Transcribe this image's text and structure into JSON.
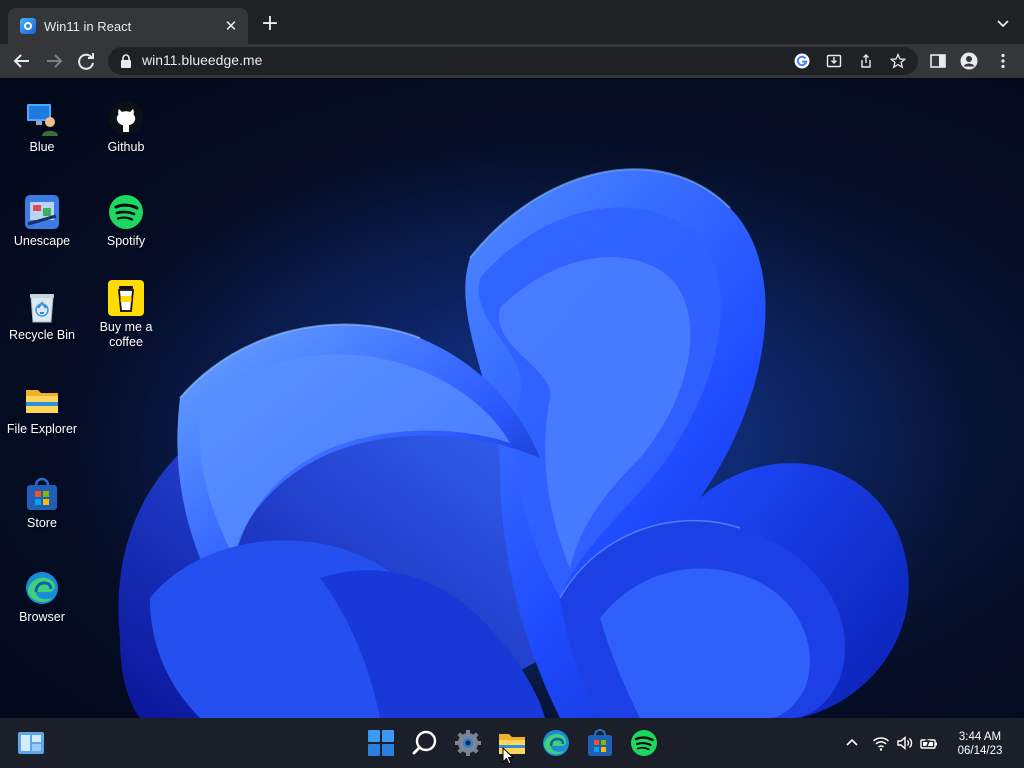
{
  "browser": {
    "tab_title": "Win11 in React",
    "tab_close": "✕",
    "new_tab": "+",
    "url": "win11.blueedge.me"
  },
  "desktop": {
    "icons": [
      {
        "label": "Blue",
        "icon": "user-pc-icon"
      },
      {
        "label": "Unescape",
        "icon": "unescape-icon"
      },
      {
        "label": "Recycle Bin",
        "icon": "recycle-bin-icon"
      },
      {
        "label": "File Explorer",
        "icon": "folder-icon"
      },
      {
        "label": "Store",
        "icon": "store-icon"
      },
      {
        "label": "Browser",
        "icon": "edge-icon"
      },
      {
        "label": "Github",
        "icon": "github-icon"
      },
      {
        "label": "Spotify",
        "icon": "spotify-icon"
      },
      {
        "label": "Buy me a coffee",
        "icon": "coffee-cup-icon"
      }
    ]
  },
  "taskbar": {
    "items": [
      "widgets-icon",
      "start-icon",
      "search-icon",
      "settings-icon",
      "file-explorer-icon",
      "edge-icon",
      "store-icon",
      "spotify-icon"
    ],
    "active": "file-explorer-icon",
    "tray": [
      "chevron-up-icon",
      "wifi-icon",
      "volume-icon",
      "battery-icon"
    ],
    "time": "3:44 AM",
    "date": "06/14/23"
  },
  "colors": {
    "chrome_dark": "#202124",
    "chrome_tab": "#35363a",
    "taskbar": "#1b1f2a",
    "accent_blue": "#1f5cff",
    "spotify_green": "#1ed760"
  }
}
